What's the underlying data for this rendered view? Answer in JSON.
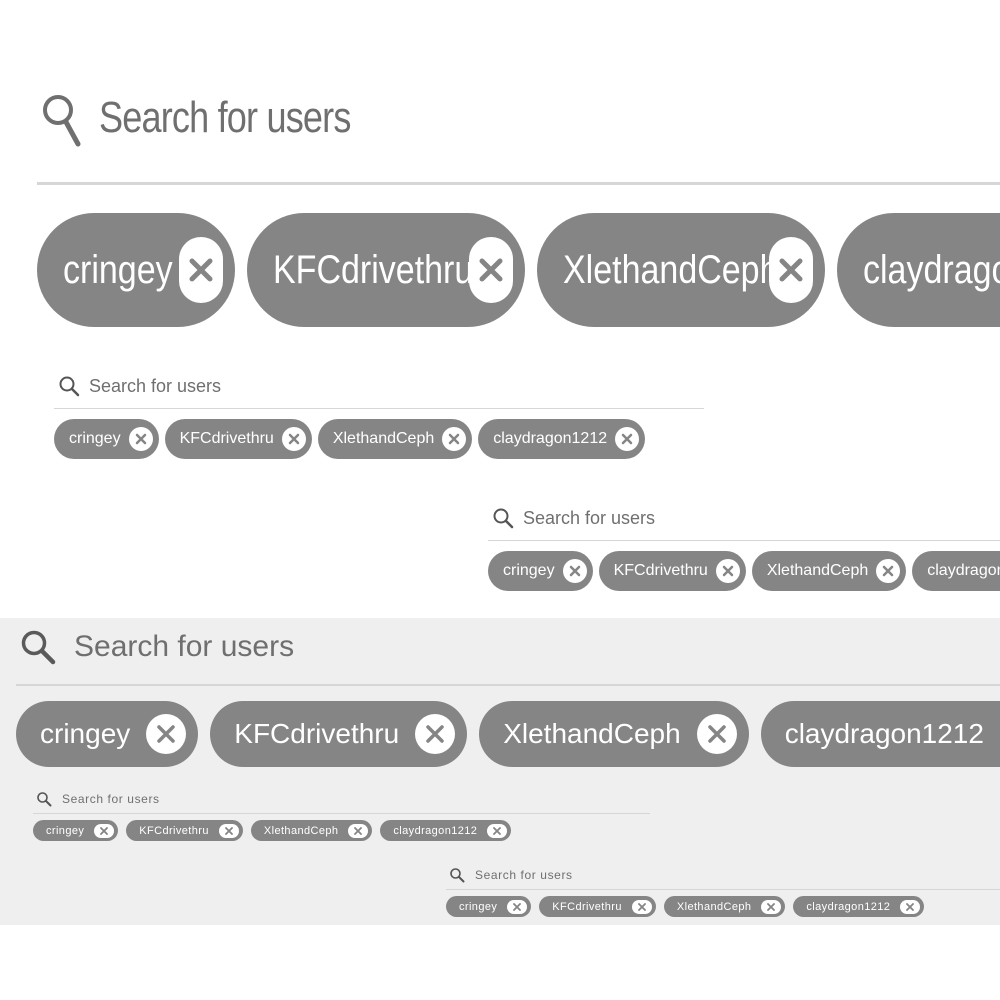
{
  "search": {
    "placeholder": "Search for users",
    "icon": "search-icon"
  },
  "chips": [
    {
      "label": "cringey",
      "remove_icon": "close-circle-icon"
    },
    {
      "label": "KFCdrivethru",
      "remove_icon": "close-circle-icon"
    },
    {
      "label": "XlethandCeph",
      "remove_icon": "close-circle-icon"
    },
    {
      "label": "claydragon1212",
      "remove_icon": "close-circle-icon"
    }
  ],
  "colors": {
    "chip_background": "#858585",
    "chip_text": "#ffffff",
    "placeholder_text": "#6f6f6f",
    "divider": "#d6d6d6",
    "band_background": "#efefef"
  }
}
